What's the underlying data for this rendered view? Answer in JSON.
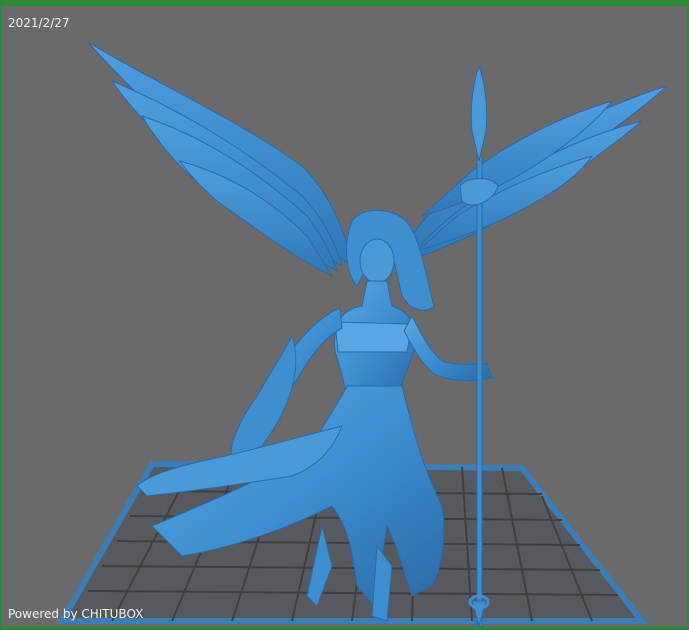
{
  "viewport": {
    "date": "2021/2/27",
    "powered_by": "Powered by CHITUBOX"
  },
  "model": {
    "name": "angel-figure",
    "color": "#3d8fd0"
  },
  "colors": {
    "background": "#6a6a6a",
    "frame": "#2a8a3a",
    "build_plate": "#3a7db8",
    "model": "#3d8fd0",
    "model_shadow": "#2a6aa6",
    "model_highlight": "#6cb2ea"
  }
}
